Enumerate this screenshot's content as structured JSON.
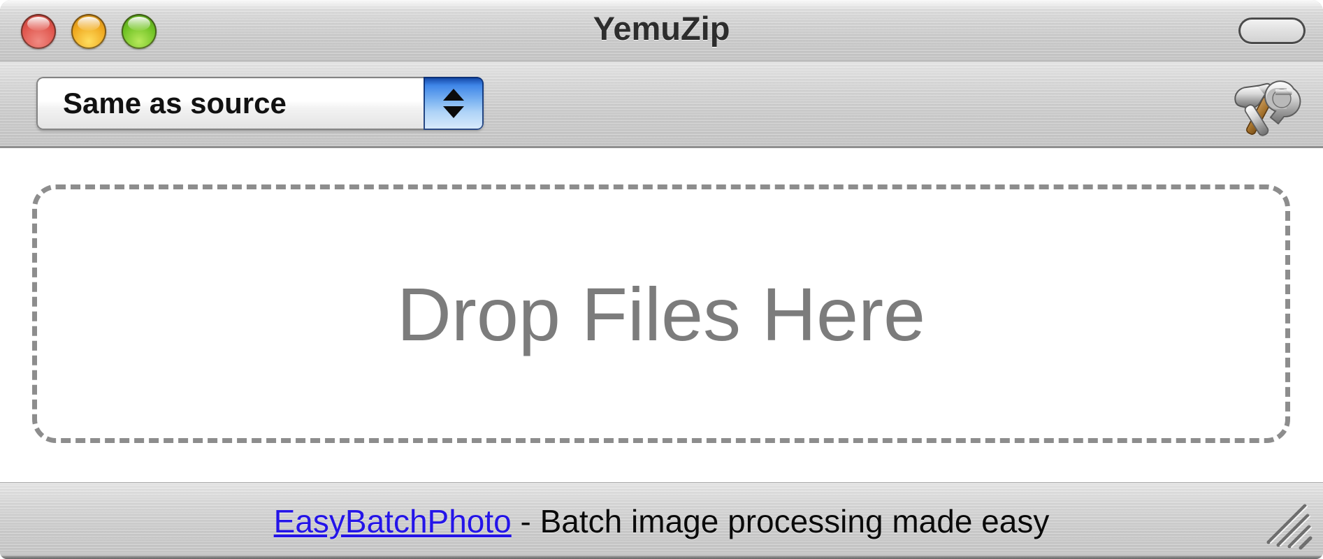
{
  "window": {
    "title": "YemuZip",
    "controls": {
      "close_label": "close",
      "minimize_label": "minimize",
      "zoom_label": "zoom",
      "toolbar_toggle_label": "toggle-toolbar"
    }
  },
  "toolbar": {
    "format_popup": {
      "selected": "Same as source",
      "options": [
        "Same as source"
      ]
    },
    "tools_icon_name": "hammer-and-wrench-icon"
  },
  "content": {
    "drop_zone": {
      "label": "Drop Files Here"
    }
  },
  "footer": {
    "link_text": "EasyBatchPhoto",
    "tagline": " - Batch image processing made easy",
    "resize_grip_name": "resize-grip"
  },
  "colors": {
    "link": "#2414e8",
    "drop_text": "#7c7c7c",
    "dashed_border": "#8d8d8d",
    "stepper_blue": "#3f86e8",
    "metal_base": "#c9c9c9",
    "title_text": "#2d2d2d"
  }
}
